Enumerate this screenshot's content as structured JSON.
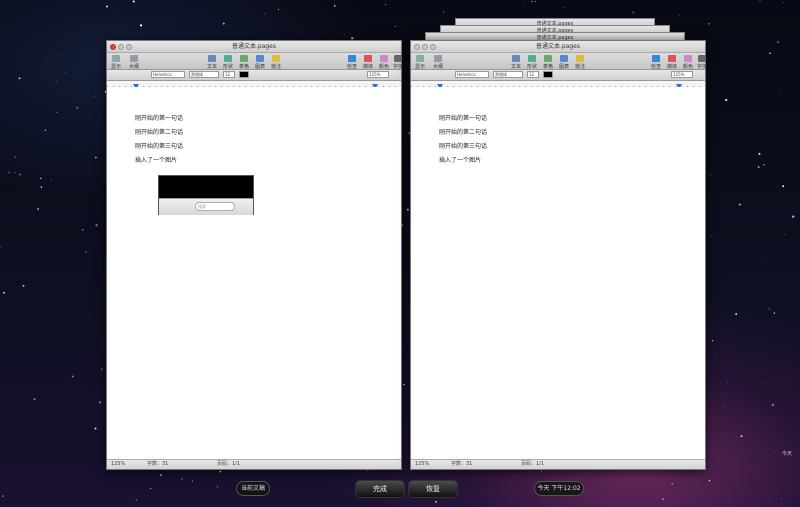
{
  "colors": {
    "accent": "#2d6cd8",
    "close_button": "#e0443e",
    "desktop": "#0a0d1a"
  },
  "left_window": {
    "title": "普通文本.pages",
    "lines": [
      "刚开始的第一句话",
      "刚开始的第二句话",
      "刚开始的第三句话",
      "插入了一个图片"
    ],
    "status": {
      "zoom": "125%",
      "words": "字数：31",
      "pages": "页码：1/1"
    },
    "embedded_screenshot": {
      "field_placeholder": "搜索"
    }
  },
  "right_window": {
    "title": "普通文本.pages",
    "stack_titles": [
      "普通文本.pages",
      "普通文本.pages",
      "普通文本.pages"
    ],
    "lines": [
      "刚开始的第一句话",
      "刚开始的第二句话",
      "刚开始的第三句话",
      "插入了一个图片"
    ],
    "status": {
      "zoom": "125%",
      "words": "字数：31",
      "pages": "页码：1/1"
    }
  },
  "toolbar": {
    "items": [
      {
        "icon": "view-icon",
        "label": "显示"
      },
      {
        "icon": "sections-icon",
        "label": "大纲"
      },
      {
        "icon": "text-box-icon",
        "label": "文本框"
      },
      {
        "icon": "shapes-icon",
        "label": "形状"
      },
      {
        "icon": "table-icon",
        "label": "表格"
      },
      {
        "icon": "chart-icon",
        "label": "图表"
      },
      {
        "icon": "comment-icon",
        "label": "批注"
      },
      {
        "icon": "inspector-icon",
        "label": "检查器"
      },
      {
        "icon": "media-icon",
        "label": "媒体"
      },
      {
        "icon": "colors-icon",
        "label": "颜色"
      },
      {
        "icon": "fonts-icon",
        "label": "字体"
      }
    ]
  },
  "formatbar": {
    "font": "Helvetica",
    "style": "常规体",
    "size": "12",
    "zoom": "125%"
  },
  "time_machine": {
    "current_doc_label": "当前文稿",
    "done_button": "完成",
    "restore_button": "恢复",
    "timestamp": "今天 下午12:02",
    "edge_label": "今天"
  }
}
